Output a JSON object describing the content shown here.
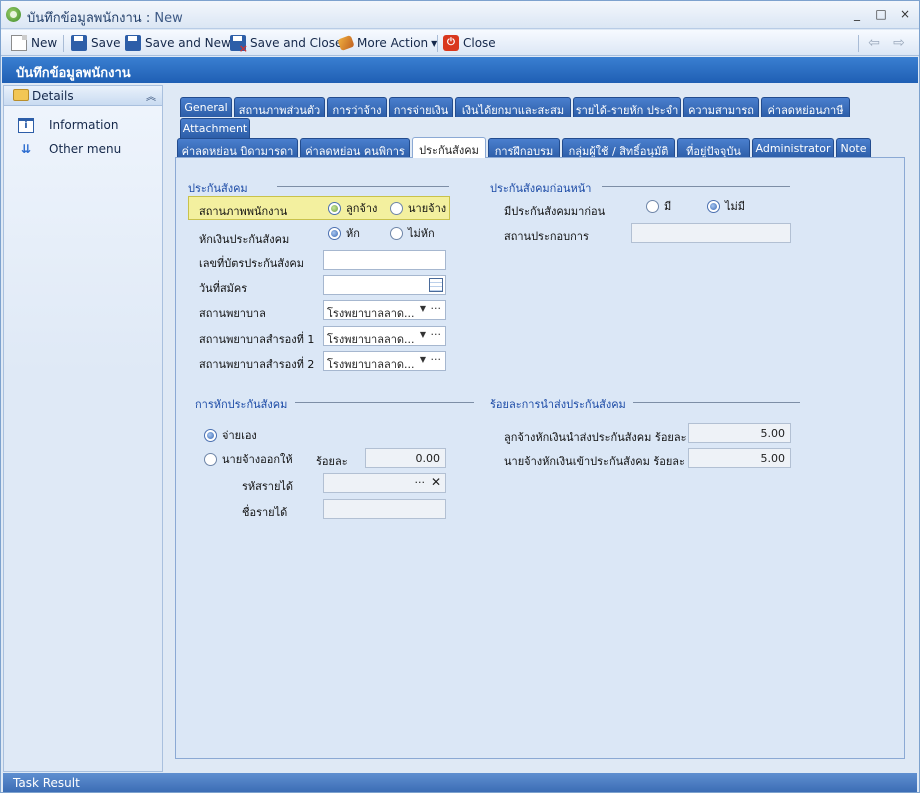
{
  "window": {
    "title": "บันทึกข้อมูลพนักงาน",
    "title_sep": ":",
    "mode": "New",
    "controls": [
      "_",
      "□",
      "×"
    ]
  },
  "toolbar": {
    "new_label": "New",
    "save_label": "Save",
    "save_new_label": "Save and New",
    "save_close_label": "Save and Close",
    "more_action_label": "More Action",
    "close_label": "Close"
  },
  "header": {
    "title": "บันทึกข้อมูลพนักงาน"
  },
  "sidebar": {
    "group_label": "Details",
    "items": [
      {
        "label": "Information",
        "icon": "info-icon"
      },
      {
        "label": "Other menu",
        "icon": "chevron-double-down-icon"
      }
    ]
  },
  "tabs_row1": [
    "General",
    "สถานภาพส่วนตัว",
    "การว่าจ้าง",
    "การจ่ายเงิน",
    "เงินได้ยกมาและสะสม",
    "รายได้-รายหัก ประจำ",
    "ความสามารถ",
    "ค่าลดหย่อนภาษี",
    "Attachment"
  ],
  "tabs_row2": [
    "ค่าลดหย่อน บิดามารดา",
    "ค่าลดหย่อน คนพิการ",
    "ประกันสังคม",
    "การฝึกอบรม",
    "กลุ่มผู้ใช้ / สิทธิ์อนุมัติ",
    "ที่อยู่ปัจจุบัน",
    "Administrator",
    "Note"
  ],
  "selected_tab": "ประกันสังคม",
  "social_security": {
    "section_title": "ประกันสังคม",
    "employee_status_label": "สถานภาพพนักงาน",
    "status_options": [
      "ลูกจ้าง",
      "นายจ้าง"
    ],
    "status_selected": "ลูกจ้าง",
    "deduct_label": "หักเงินประกันสังคม",
    "deduct_options": [
      "หัก",
      "ไม่หัก"
    ],
    "deduct_selected": "หัก",
    "card_no_label": "เลขที่บัตรประกันสังคม",
    "card_no_value": "",
    "apply_date_label": "วันที่สมัคร",
    "apply_date_value": "",
    "hospital_label": "สถานพยาบาล",
    "hospital_value": "โรงพยาบาลลาด...",
    "hospital_alt1_label": "สถานพยาบาลสำรองที่ 1",
    "hospital_alt1_value": "โรงพยาบาลลาด...",
    "hospital_alt2_label": "สถานพยาบาลสำรองที่ 2",
    "hospital_alt2_value": "โรงพยาบาลลาด..."
  },
  "previous_ss": {
    "section_title": "ประกันสังคมก่อนหน้า",
    "had_before_label": "มีประกันสังคมมาก่อน",
    "options": [
      "มี",
      "ไม่มี"
    ],
    "selected": "ไม่มี",
    "workplace_label": "สถานประกอบการ",
    "workplace_value": ""
  },
  "deduction": {
    "section_title": "การหักประกันสังคม",
    "self_pay_label": "จ่ายเอง",
    "employer_pay_label": "นายจ้างออกให้",
    "selected": "จ่ายเอง",
    "percent_label": "ร้อยละ",
    "percent_value": "0.00",
    "income_code_label": "รหัสรายได้",
    "income_code_value": "",
    "income_name_label": "ชื่อรายได้",
    "income_name_value": ""
  },
  "remit": {
    "section_title": "ร้อยละการนำส่งประกันสังคม",
    "employee_label": "ลูกจ้างหักเงินนำส่งประกันสังคม ร้อยละ",
    "employee_value": "5.00",
    "employer_label": "นายจ้างหักเงินเข้าประกันสังคม ร้อยละ",
    "employer_value": "5.00"
  },
  "footer": {
    "task_result_label": "Task Result"
  }
}
